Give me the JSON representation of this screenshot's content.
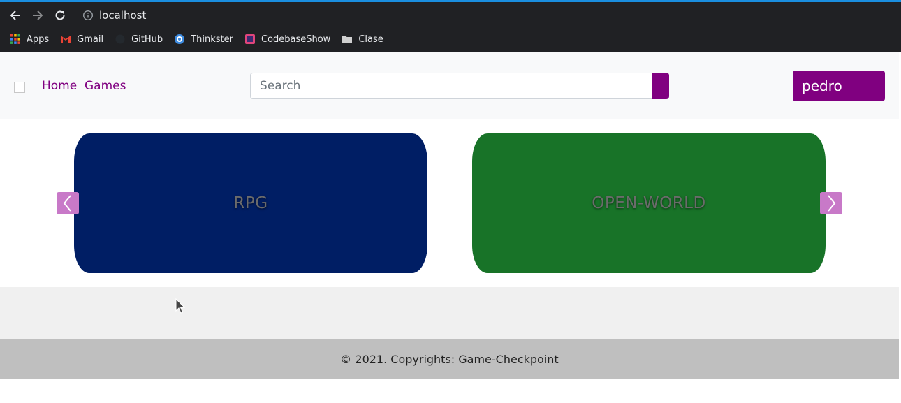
{
  "browser": {
    "url": "localhost",
    "bookmarks": [
      {
        "label": "Apps",
        "icon": "apps-grid-icon"
      },
      {
        "label": "Gmail",
        "icon": "gmail-icon"
      },
      {
        "label": "GitHub",
        "icon": "github-icon"
      },
      {
        "label": "Thinkster",
        "icon": "thinkster-icon"
      },
      {
        "label": "CodebaseShow",
        "icon": "codebaseshow-icon"
      },
      {
        "label": "Clase",
        "icon": "folder-icon"
      }
    ]
  },
  "navbar": {
    "links": [
      "Home",
      "Games"
    ],
    "search_placeholder": "Search",
    "user_label": "pedro",
    "accent_color": "#800080"
  },
  "carousel": {
    "cards": [
      {
        "label": "RPG",
        "color": "#001e64"
      },
      {
        "label": "OPEN-WORLD",
        "color": "#187328"
      }
    ]
  },
  "footer": {
    "text": "© 2021. Copyrights: Game-Checkpoint"
  }
}
